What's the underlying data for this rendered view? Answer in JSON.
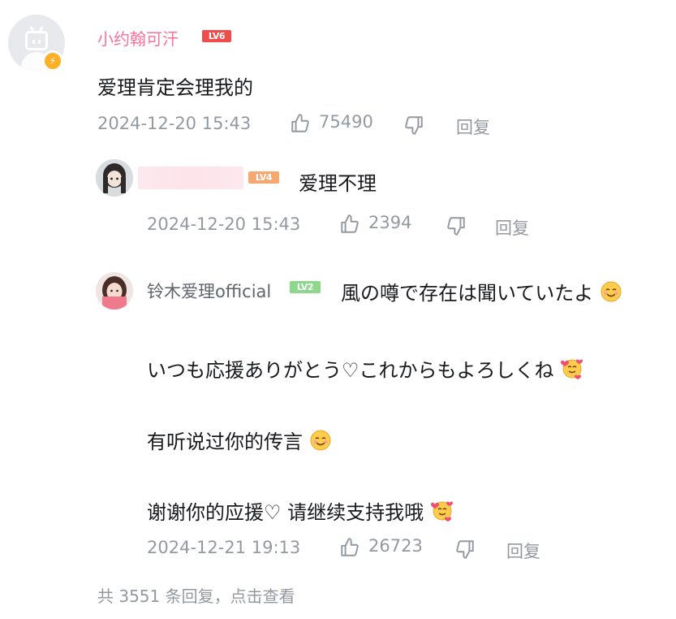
{
  "main_comment": {
    "username": "小约翰可汗",
    "level": "LV6",
    "text": "爱理肯定会理我的",
    "timestamp": "2024-12-20 15:43",
    "likes": "75490",
    "reply_label": "回复"
  },
  "replies": [
    {
      "username": "",
      "level": "LV4",
      "text": "爱理不理",
      "timestamp": "2024-12-20 15:43",
      "likes": "2394",
      "reply_label": "回复"
    },
    {
      "username": "铃木爱理official",
      "level": "LV2",
      "lines": [
        "風の噂で存在は聞いていたよ",
        "いつも応援ありがとう♡これからもよろしくね",
        "有听说过你的传言",
        "谢谢你的应援♡ 请继续支持我哦"
      ],
      "timestamp": "2024-12-21 19:13",
      "likes": "26723",
      "reply_label": "回复"
    }
  ],
  "more_replies_text": "共 3551 条回复，点击查看",
  "colors": {
    "username_pink": "#fb7299",
    "meta_gray": "#9499a0",
    "lv6": "#ef4c4c",
    "lv4": "#f5a971",
    "lv2": "#8dd88c"
  },
  "icons": [
    "like-icon",
    "dislike-icon",
    "bolt-badge-icon",
    "smile-emoji-icon",
    "hug-emoji-icon"
  ]
}
